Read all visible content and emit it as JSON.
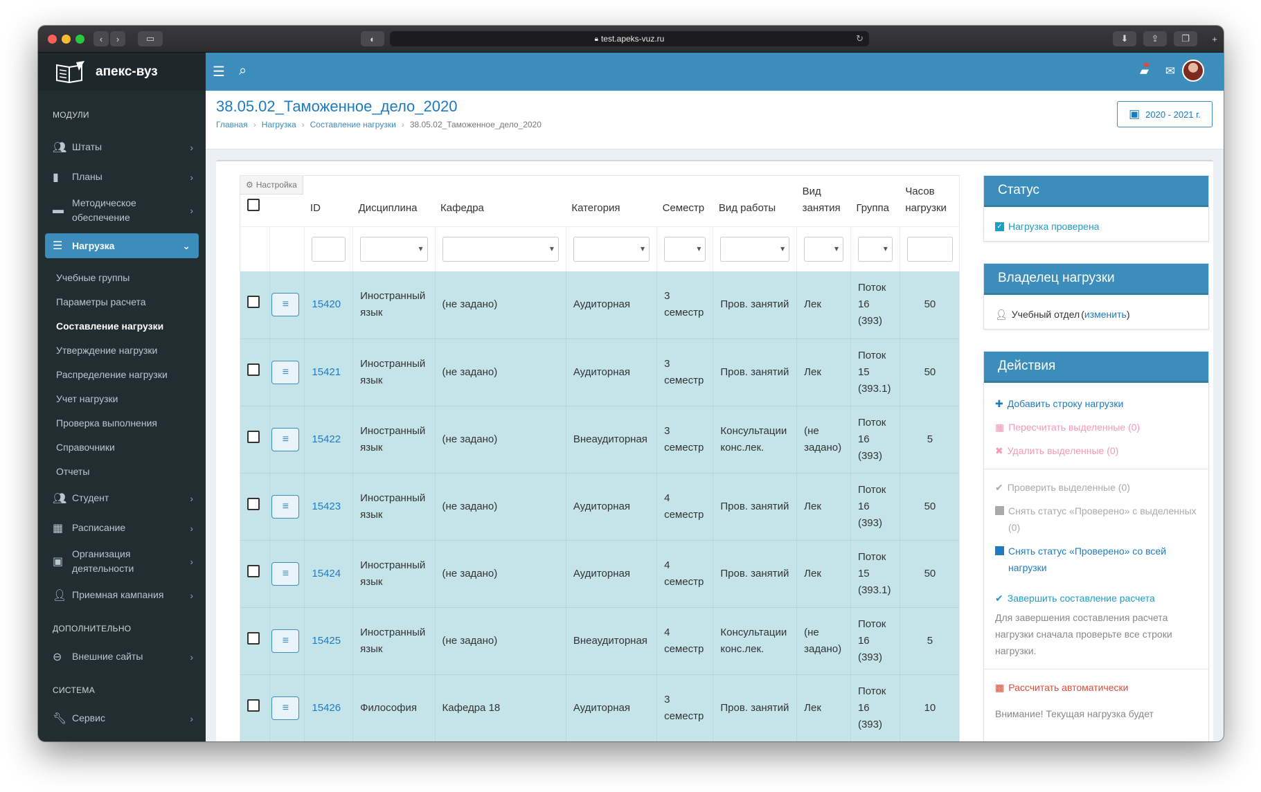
{
  "browser": {
    "url": "test.apeks-vuz.ru"
  },
  "sidebar": {
    "logo_text": "апекс-вуз",
    "section_modules": "МОДУЛИ",
    "modules": [
      {
        "label": "Штаты",
        "icon": "users-icon"
      },
      {
        "label": "Планы",
        "icon": "file-icon"
      },
      {
        "label": "Методическое обеспечение",
        "icon": "folder-icon"
      }
    ],
    "active_module": {
      "label": "Нагрузка",
      "icon": "server-icon"
    },
    "sub_items": [
      "Учебные группы",
      "Параметры расчета",
      "Составление нагрузки",
      "Утверждение нагрузки",
      "Распределение нагрузки",
      "Учет нагрузки",
      "Проверка выполнения",
      "Справочники",
      "Отчеты"
    ],
    "current_sub": "Составление нагрузки",
    "modules_more": [
      {
        "label": "Студент",
        "icon": "users-icon"
      },
      {
        "label": "Расписание",
        "icon": "calendar-icon"
      },
      {
        "label": "Организация деятельности",
        "icon": "briefcase-icon"
      },
      {
        "label": "Приемная кампания",
        "icon": "user-plus-icon"
      }
    ],
    "section_extra": "ДОПОЛНИТЕЛЬНО",
    "extra_item": {
      "label": "Внешние сайты",
      "icon": "link-icon"
    },
    "section_system": "СИСТЕМА",
    "system_item": {
      "label": "Сервис",
      "icon": "wrench-icon"
    }
  },
  "header": {
    "title": "38.05.02_Таможенное_дело_2020",
    "breadcrumb": [
      "Главная",
      "Нагрузка",
      "Составление нагрузки",
      "38.05.02_Таможенное_дело_2020"
    ],
    "year_button": "2020 - 2021 г."
  },
  "table": {
    "settings_label": "Настройка",
    "columns": [
      "ID",
      "Дисциплина",
      "Кафедра",
      "Категория",
      "Семестр",
      "Вид работы",
      "Вид занятия",
      "Группа",
      "Часов нагрузки"
    ],
    "rows": [
      {
        "id": "15420",
        "discipline": "Иностранный язык",
        "department": "(не задано)",
        "category": "Аудиторная",
        "semester": "3 семестр",
        "work_type": "Пров. занятий",
        "lesson_type": "Лек",
        "group": "Поток 16 (393)",
        "hours": "50"
      },
      {
        "id": "15421",
        "discipline": "Иностранный язык",
        "department": "(не задано)",
        "category": "Аудиторная",
        "semester": "3 семестр",
        "work_type": "Пров. занятий",
        "lesson_type": "Лек",
        "group": "Поток 15 (393.1)",
        "hours": "50"
      },
      {
        "id": "15422",
        "discipline": "Иностранный язык",
        "department": "(не задано)",
        "category": "Внеаудиторная",
        "semester": "3 семестр",
        "work_type": "Консультации конс.лек.",
        "lesson_type": "(не задано)",
        "group": "Поток 16 (393)",
        "hours": "5"
      },
      {
        "id": "15423",
        "discipline": "Иностранный язык",
        "department": "(не задано)",
        "category": "Аудиторная",
        "semester": "4 семестр",
        "work_type": "Пров. занятий",
        "lesson_type": "Лек",
        "group": "Поток 16 (393)",
        "hours": "50"
      },
      {
        "id": "15424",
        "discipline": "Иностранный язык",
        "department": "(не задано)",
        "category": "Аудиторная",
        "semester": "4 семестр",
        "work_type": "Пров. занятий",
        "lesson_type": "Лек",
        "group": "Поток 15 (393.1)",
        "hours": "50"
      },
      {
        "id": "15425",
        "discipline": "Иностранный язык",
        "department": "(не задано)",
        "category": "Внеаудиторная",
        "semester": "4 семестр",
        "work_type": "Консультации конс.лек.",
        "lesson_type": "(не задано)",
        "group": "Поток 16 (393)",
        "hours": "5"
      },
      {
        "id": "15426",
        "discipline": "Философия",
        "department": "Кафедра 18",
        "category": "Аудиторная",
        "semester": "3 семестр",
        "work_type": "Пров. занятий",
        "lesson_type": "Лек",
        "group": "Поток 16 (393)",
        "hours": "10"
      }
    ]
  },
  "status_box": {
    "title": "Статус",
    "value": "Нагрузка проверена"
  },
  "owner_box": {
    "title": "Владелец нагрузки",
    "owner": "Учебный отдел",
    "change_link": "изменить"
  },
  "actions_box": {
    "title": "Действия",
    "add_row": "Добавить строку нагрузки",
    "recalc_selected": "Пересчитать выделенные (0)",
    "delete_selected": "Удалить выделенные (0)",
    "check_selected": "Проверить выделенные (0)",
    "uncheck_selected": "Снять статус «Проверено» с выделенных (0)",
    "uncheck_all": "Снять статус «Проверено» со всей нагрузки",
    "finish": "Завершить составление расчета",
    "finish_note": "Для завершения составления расчета нагрузки сначала проверьте все строки нагрузки.",
    "auto_calc": "Рассчитать автоматически",
    "auto_note": "Внимание! Текущая нагрузка будет"
  },
  "colors": {
    "primary": "#3c8dbc",
    "sidebar": "#222d32",
    "row_bg": "#c5e4ea",
    "link": "#1d7bc1",
    "danger": "#dd4b39"
  }
}
